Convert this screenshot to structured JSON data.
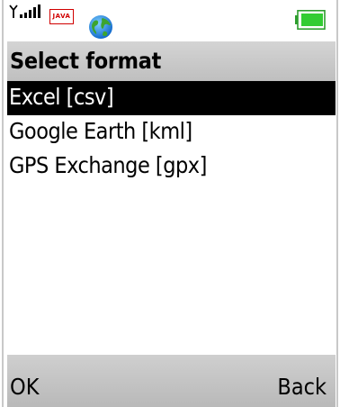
{
  "status_bar": {
    "signal_icon": "signal-strength-icon",
    "java_label": "JAVA",
    "globe_icon": "globe-icon",
    "battery_icon": "battery-icon"
  },
  "title": "Select format",
  "formats": [
    {
      "label": "Excel [csv]",
      "selected": true
    },
    {
      "label": "Google Earth [kml]",
      "selected": false
    },
    {
      "label": "GPS Exchange [gpx]",
      "selected": false
    }
  ],
  "softkeys": {
    "left": "OK",
    "right": "Back"
  },
  "colors": {
    "selection_bg": "#000000",
    "selection_fg": "#ffffff",
    "bar_bg": "#c8c8c8",
    "battery_fill": "#33cc33"
  }
}
